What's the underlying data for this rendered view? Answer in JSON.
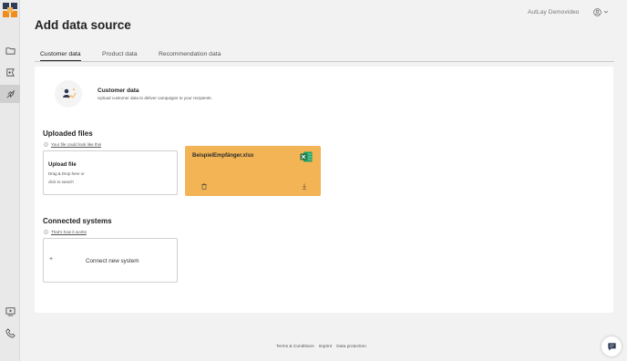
{
  "app": {
    "title": "Add data source",
    "user": "AutLay Demovideo"
  },
  "colors": {
    "accent": "#f2b454",
    "excel": "#1d7044",
    "brand_orange": "#f08c1b",
    "brand_dark": "#2f3b55"
  },
  "sidebar": {
    "items": [
      {
        "icon": "folder-icon"
      },
      {
        "icon": "megaphone-icon"
      },
      {
        "icon": "rocket-icon",
        "active": true
      },
      {
        "icon": "video-icon"
      },
      {
        "icon": "phone-icon"
      }
    ]
  },
  "tabs": [
    {
      "label": "Customer data",
      "active": true
    },
    {
      "label": "Product data"
    },
    {
      "label": "Recommendation data"
    }
  ],
  "datasource": {
    "title": "Customer data",
    "description": "Upload customer data to deliver campaigns to your recipients."
  },
  "uploaded": {
    "title": "Uploaded files",
    "hint": "Your file could look like this",
    "upload_title": "Upload file",
    "upload_line1": "Drag & Drop here or",
    "upload_line2": "click to search",
    "file_name": "BeispielEmpfänger.xlsx"
  },
  "connected": {
    "title": "Connected systems",
    "hint": "That's how it works",
    "plus": "+",
    "connect_label": "Connect new system"
  },
  "footer": {
    "terms": "Terms & Conditions",
    "imprint": "Imprint",
    "privacy": "Data protection"
  }
}
